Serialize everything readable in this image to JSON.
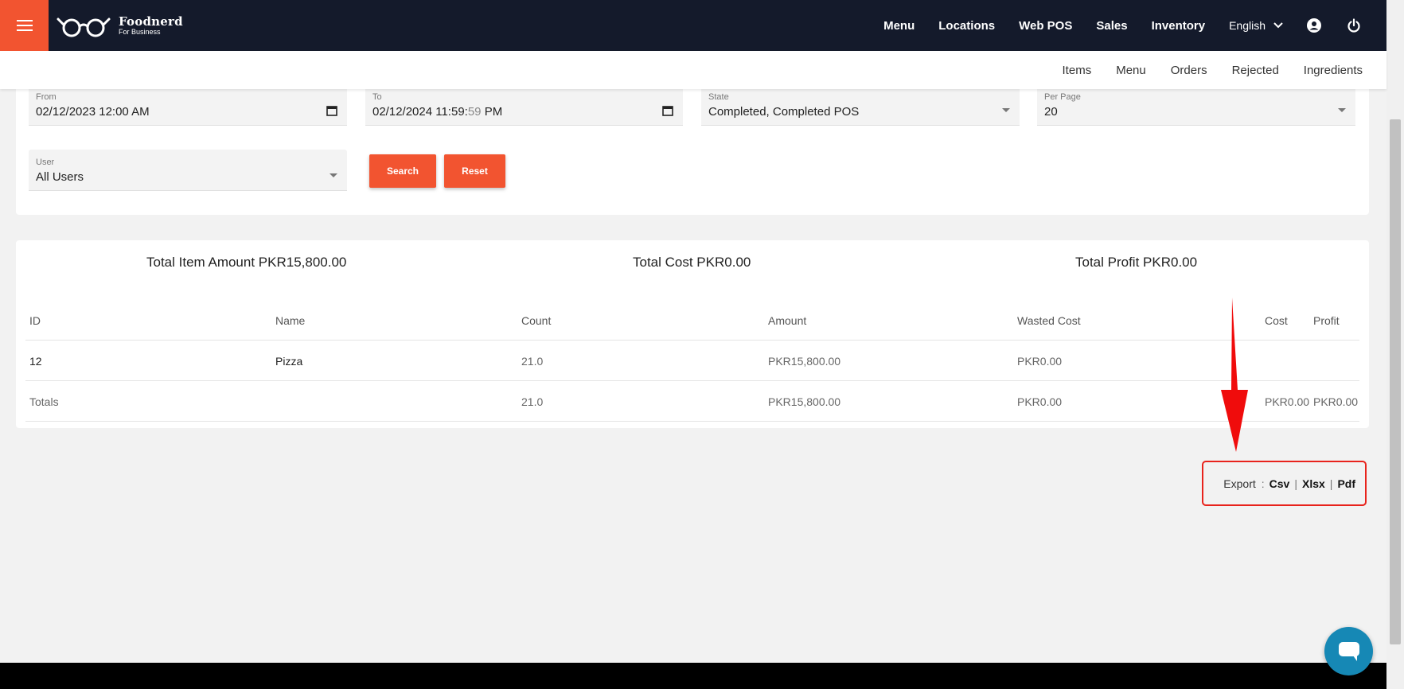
{
  "header": {
    "brand": "Foodnerd",
    "brand_sub": "For Business",
    "nav": [
      "Menu",
      "Locations",
      "Web POS",
      "Sales",
      "Inventory"
    ],
    "language": "English"
  },
  "subnav": [
    "Items",
    "Menu",
    "Orders",
    "Rejected",
    "Ingredients"
  ],
  "filters": {
    "from_label": "From",
    "from_value": "02/12/2023 12:00 AM",
    "to_label": "To",
    "to_value_main": "02/12/2024 11:59:",
    "to_value_dim": "59",
    "to_value_tail": " PM",
    "state_label": "State",
    "state_value": "Completed, Completed POS",
    "per_page_label": "Per Page",
    "per_page_value": "20",
    "user_label": "User",
    "user_value": "All Users",
    "search_label": "Search",
    "reset_label": "Reset"
  },
  "summary": {
    "total_item_amount": "Total Item Amount PKR15,800.00",
    "total_cost": "Total Cost PKR0.00",
    "total_profit": "Total Profit PKR0.00"
  },
  "table": {
    "columns": [
      "ID",
      "Name",
      "Count",
      "Amount",
      "Wasted Cost",
      "Cost",
      "Profit"
    ],
    "rows": [
      {
        "id": "12",
        "name": "Pizza",
        "count": "21.0",
        "amount": "PKR15,800.00",
        "wasted_cost": "PKR0.00",
        "cost": "",
        "profit": ""
      }
    ],
    "totals": {
      "label": "Totals",
      "count": "21.0",
      "amount": "PKR15,800.00",
      "wasted_cost": "PKR0.00",
      "cost": "PKR0.00",
      "profit": "PKR0.00"
    }
  },
  "export": {
    "label": "Export",
    "colon": ":",
    "csv": "Csv",
    "xlsx": "Xlsx",
    "pdf": "Pdf",
    "separator": "|"
  },
  "colors": {
    "accent": "#f25430",
    "topbar": "#141a2b",
    "highlight": "#e8231c",
    "chat": "#1688b5"
  }
}
